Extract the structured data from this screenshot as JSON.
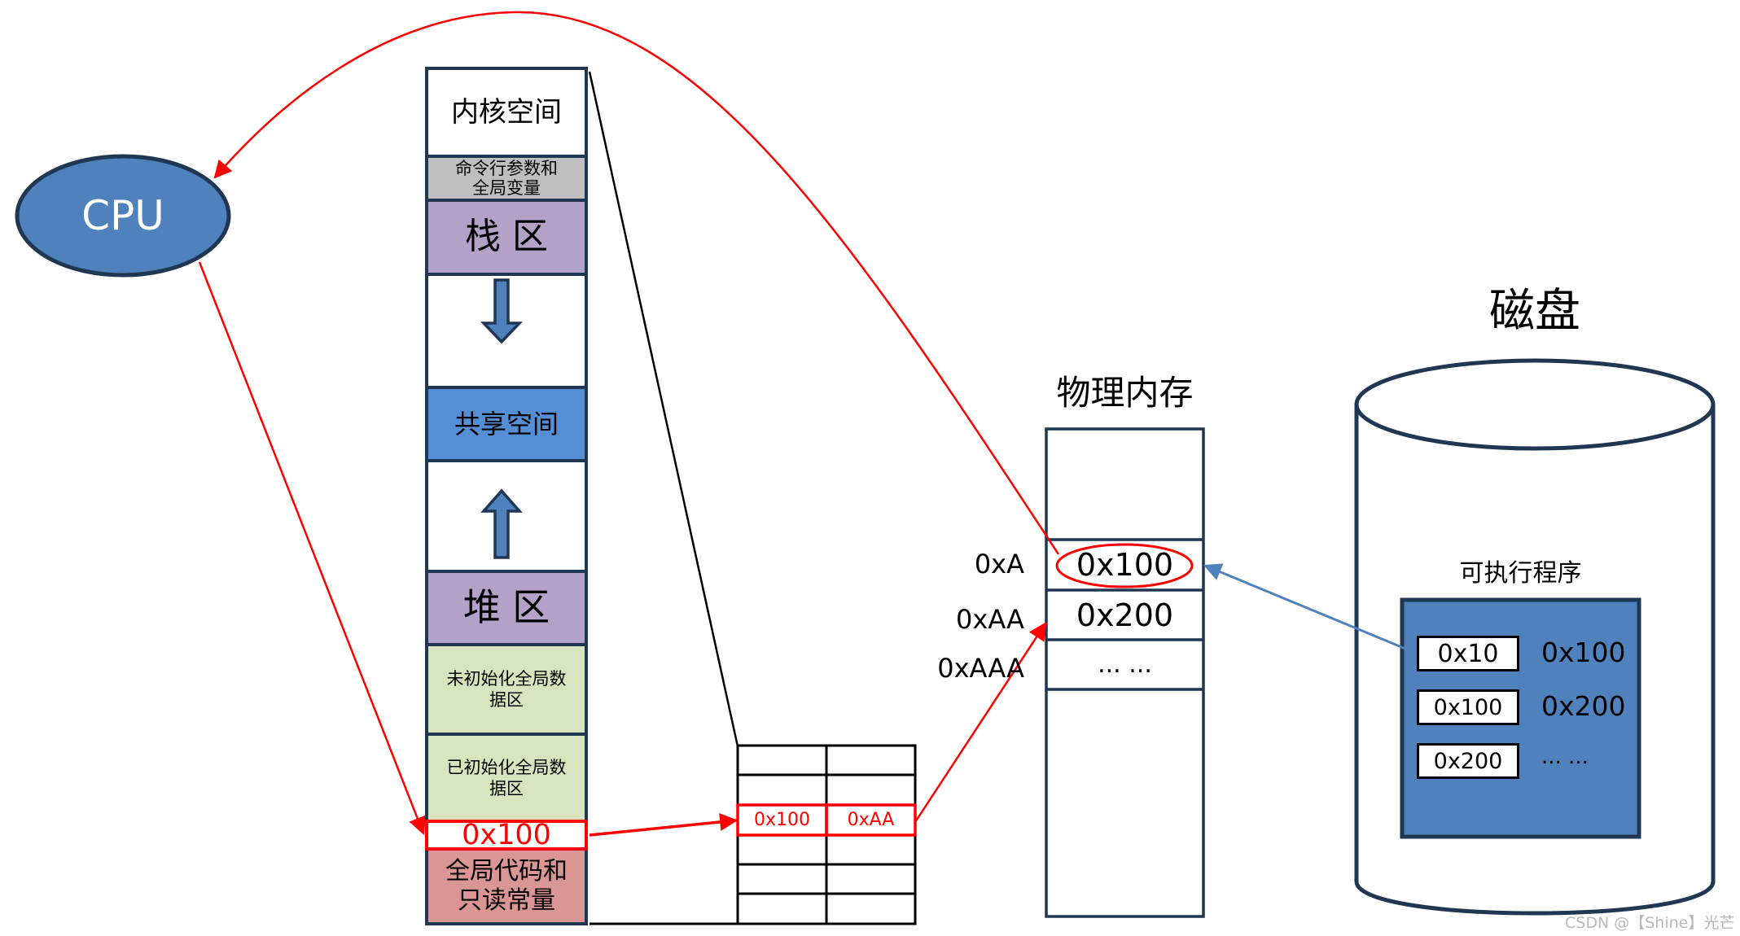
{
  "colors": {
    "outline": "#1F3752",
    "cpu_fill": "#4F81BD",
    "kernel_fill": "#FFFFFF",
    "cmdline_fill": "#BFBFBF",
    "stack_fill": "#B2A2C7",
    "shared_fill": "#558ED5",
    "heap_fill": "#B2A2C7",
    "data_fill": "#D7E4BD",
    "code_fill": "#D99694",
    "highlight": "#FF0000",
    "disk_link": "#4F81BD"
  },
  "cpu": {
    "label": "CPU"
  },
  "process_space": {
    "segments": [
      {
        "id": "kernel",
        "label": "内核空间"
      },
      {
        "id": "cmdline",
        "label": "命令行参数和全局变量",
        "line1": "命令行参数和",
        "line2": "全局变量"
      },
      {
        "id": "stack",
        "label": "栈 区"
      },
      {
        "id": "gap-down",
        "label": "",
        "arrow": "down"
      },
      {
        "id": "shared",
        "label": "共享空间"
      },
      {
        "id": "gap-up",
        "label": "",
        "arrow": "up"
      },
      {
        "id": "heap",
        "label": "堆 区"
      },
      {
        "id": "bss",
        "label": "未初始化全局数据区",
        "line1": "未初始化全局数",
        "line2": "据区"
      },
      {
        "id": "data",
        "label": "已初始化全局数据区",
        "line1": "已初始化全局数",
        "line2": "据区"
      },
      {
        "id": "highlight-addr",
        "label": "0x100"
      },
      {
        "id": "code",
        "label": "全局代码和只读常量",
        "line1": "全局代码和",
        "line2": "只读常量"
      }
    ]
  },
  "page_table": {
    "rows": [
      [
        "",
        ""
      ],
      [
        "",
        ""
      ],
      [
        "0x100",
        "0xAA"
      ],
      [
        "",
        ""
      ],
      [
        "",
        ""
      ],
      [
        "",
        ""
      ]
    ],
    "highlighted_row": 2
  },
  "physical_memory": {
    "title": "物理内存",
    "cells": [
      {
        "addr": "",
        "value": ""
      },
      {
        "addr": "0xA",
        "value": "0x100",
        "circled": true
      },
      {
        "addr": "0xAA",
        "value": "0x200"
      },
      {
        "addr": "0xAAA",
        "value": "... ..."
      },
      {
        "addr": "",
        "value": ""
      }
    ]
  },
  "disk": {
    "title": "磁盘",
    "executable": {
      "title": "可执行程序",
      "entries": [
        {
          "address": "0x10",
          "content": "0x100"
        },
        {
          "address": "0x100",
          "content": "0x200"
        },
        {
          "address": "0x200",
          "content": "... ..."
        }
      ]
    }
  },
  "watermark": "CSDN @【Shine】光芒"
}
